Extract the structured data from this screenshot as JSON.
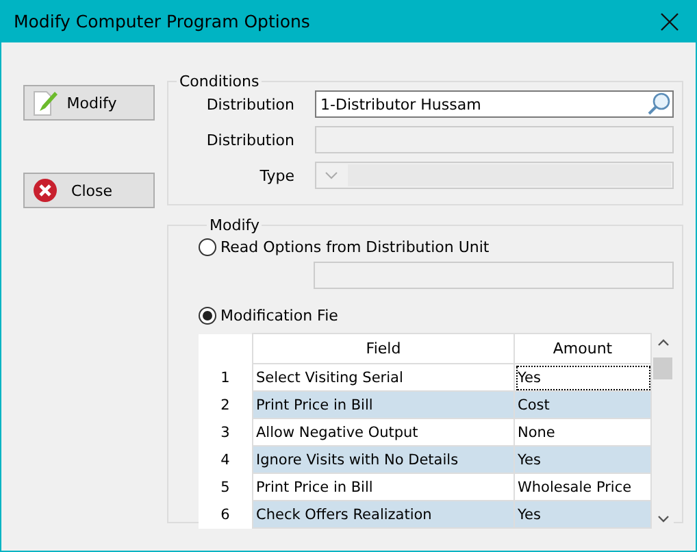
{
  "window": {
    "title": "Modify Computer Program Options"
  },
  "buttons": [
    {
      "kind": "edit",
      "label": "Modify"
    },
    {
      "kind": "close",
      "label": "Close"
    }
  ],
  "conditions": {
    "title": "Conditions",
    "fields": [
      {
        "kind": "search",
        "label": "Distribution",
        "value": "1-Distributor Hussam"
      },
      {
        "kind": "text",
        "label": "Distribution"
      },
      {
        "kind": "dropdown",
        "label": "Type"
      }
    ]
  },
  "modify": {
    "title": "Modify",
    "options": [
      {
        "label": "Read Options from Distribution Unit",
        "selected": false
      },
      {
        "label": "Modification Fie",
        "selected": true
      }
    ],
    "table": {
      "columns": [
        "Field",
        "Amount"
      ],
      "rows": [
        {
          "number": "1",
          "field": "Select Visiting Serial",
          "amount": "Yes",
          "focused": true
        },
        {
          "number": "2",
          "field": "Print Price in Bill",
          "amount": "Cost",
          "focused": false
        },
        {
          "number": "3",
          "field": "Allow Negative Output",
          "amount": "None",
          "focused": false
        },
        {
          "number": "4",
          "field": "Ignore Visits with No Details",
          "amount": "Yes",
          "focused": false
        },
        {
          "number": "5",
          "field": "Print Price in Bill",
          "amount": "Wholesale Price",
          "focused": false
        },
        {
          "number": "6",
          "field": "Check Offers Realization",
          "amount": "Yes",
          "focused": false
        }
      ]
    }
  }
}
